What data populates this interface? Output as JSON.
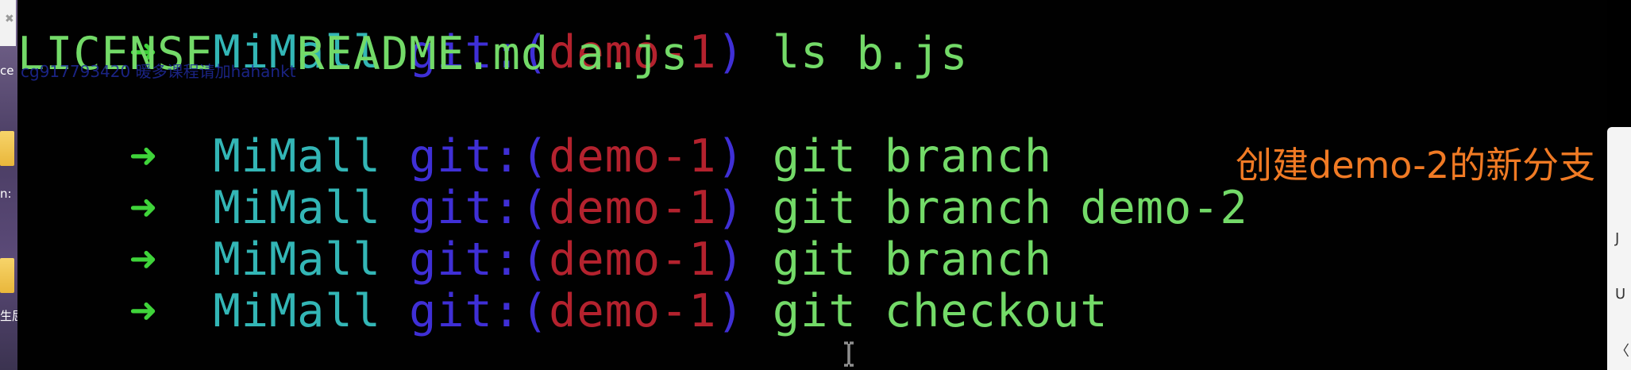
{
  "left_strip": {
    "close_glyph": "✖",
    "texts": [
      "ce",
      "n:",
      "生屈"
    ]
  },
  "terminal": {
    "lines": [
      {
        "arrow": "➜",
        "dir": "MiMall",
        "git": "git:(",
        "branch": "demo-1",
        "git_close": ")",
        "cmd": "ls"
      },
      {
        "output": "LICENSE   README.md a.js      b.js"
      },
      {
        "arrow": "➜",
        "dir": "MiMall",
        "git": "git:(",
        "branch": "demo-1",
        "git_close": ")",
        "cmd": "git branch"
      },
      {
        "arrow": "➜",
        "dir": "MiMall",
        "git": "git:(",
        "branch": "demo-1",
        "git_close": ")",
        "cmd": "git branch demo-2"
      },
      {
        "arrow": "➜",
        "dir": "MiMall",
        "git": "git:(",
        "branch": "demo-1",
        "git_close": ")",
        "cmd": "git branch"
      },
      {
        "arrow": "➜",
        "dir": "MiMall",
        "git": "git:(",
        "branch": "demo-1",
        "git_close": ")",
        "cmd": "git checkout"
      }
    ],
    "watermark": "cg917793420 暖多课程请加hahankt",
    "annotation": "创建demo-2的新分支"
  },
  "right_panel": {
    "glyphs": [
      "J",
      "U",
      "〈"
    ]
  },
  "icons": {
    "arrow": "arrow-right-icon",
    "cursor": "text-cursor-icon",
    "folder": "folder-icon"
  },
  "colors": {
    "background": "#010101",
    "arrow": "#3fd43a",
    "directory": "#33b6b6",
    "git": "#3f2fd6",
    "branch": "#b4222e",
    "command": "#73da68",
    "annotation": "#f07a24"
  }
}
